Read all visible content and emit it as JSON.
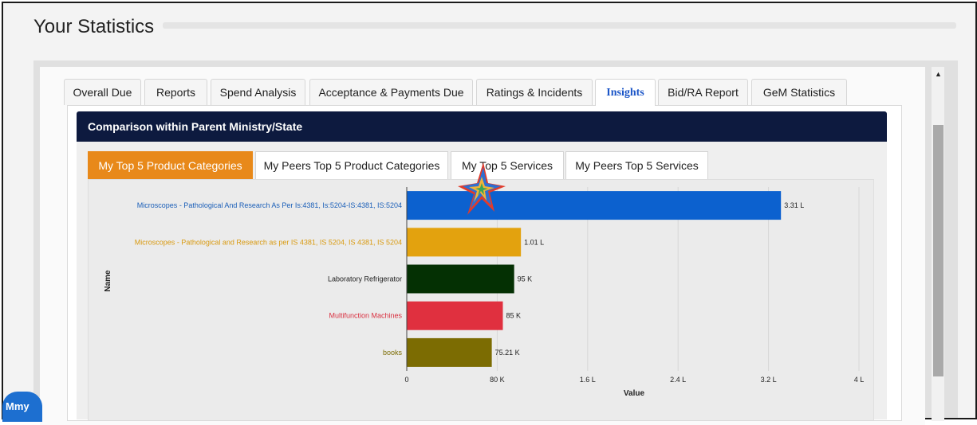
{
  "page": {
    "title": "Your Statistics"
  },
  "tabs": [
    {
      "label": "Overall Due",
      "active": false
    },
    {
      "label": "Reports",
      "active": false
    },
    {
      "label": "Spend Analysis",
      "active": false
    },
    {
      "label": "Acceptance & Payments Due",
      "active": false
    },
    {
      "label": "Ratings & Incidents",
      "active": false
    },
    {
      "label": "Insights",
      "active": true
    },
    {
      "label": "Bid/RA Report",
      "active": false
    },
    {
      "label": "GeM Statistics",
      "active": false
    }
  ],
  "section": {
    "title": "Comparison within Parent Ministry/State"
  },
  "subtabs": [
    {
      "label": "My Top 5 Product Categories",
      "active": true
    },
    {
      "label": "My Peers Top 5 Product Categories",
      "active": false
    },
    {
      "label": "My Top 5 Services",
      "active": false
    },
    {
      "label": "My Peers Top 5 Services",
      "active": false
    }
  ],
  "chat": {
    "label": "Mmy"
  },
  "chart_data": {
    "type": "bar",
    "orientation": "horizontal",
    "xlabel": "Value",
    "ylabel": "Name",
    "xlim": [
      0,
      400000
    ],
    "x_ticks": [
      {
        "value": 0,
        "label": "0"
      },
      {
        "value": 80000,
        "label": "80 K"
      },
      {
        "value": 160000,
        "label": "1.6 L"
      },
      {
        "value": 240000,
        "label": "2.4 L"
      },
      {
        "value": 320000,
        "label": "3.2 L"
      },
      {
        "value": 400000,
        "label": "4 L"
      }
    ],
    "categories": [
      "Microscopes - Pathological And Research As Per Is:4381, Is:5204-IS:4381, IS:5204",
      "Microscopes - Pathological and Research as per IS 4381, IS 5204, IS 4381, IS 5204",
      "Laboratory Refrigerator",
      "Multifunction Machines",
      "books"
    ],
    "values": [
      331000,
      101000,
      95000,
      85000,
      75210
    ],
    "value_labels": [
      "3.31 L",
      "1.01 L",
      "95 K",
      "85 K",
      "75.21 K"
    ],
    "colors": [
      "#0c61cf",
      "#e3a20e",
      "#043003",
      "#e0303f",
      "#7c6c02"
    ],
    "label_colors": [
      "#1b5fb8",
      "#d99a10",
      "#222222",
      "#d93040",
      "#7c6c02"
    ],
    "grid": true
  }
}
